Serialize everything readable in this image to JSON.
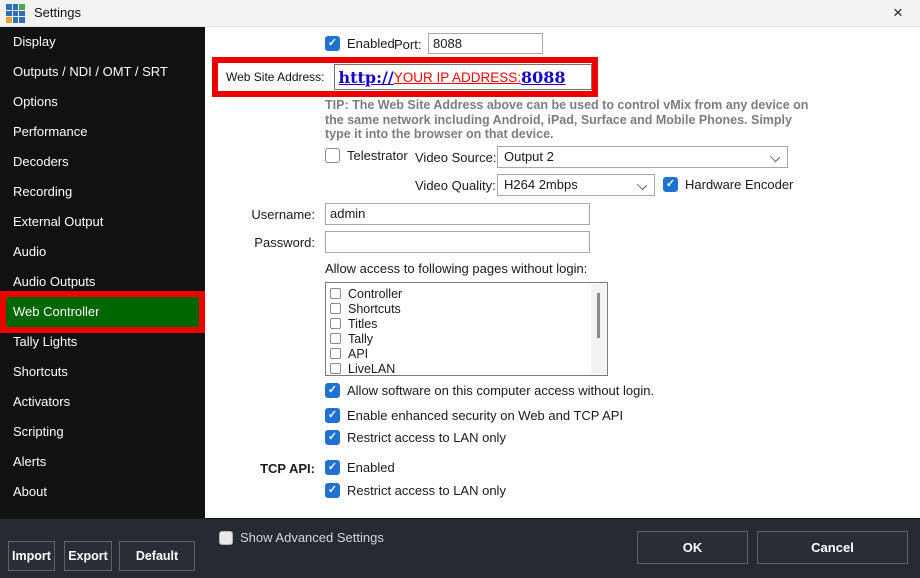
{
  "window": {
    "title": "Settings",
    "close_glyph": "×"
  },
  "colors": {
    "accent_checkbox_blue": "#1f72d1",
    "selected_item_green": "#006600",
    "annotation_red": "#ee0000",
    "url_blue": "#1803d1",
    "url_red": "#ff0000",
    "sidebar_bg": "#0f1113",
    "bottombar_bg": "#262b33"
  },
  "sidebar": {
    "items": [
      {
        "label": "Display",
        "selected": false
      },
      {
        "label": "Outputs / NDI / OMT / SRT",
        "selected": false
      },
      {
        "label": "Options",
        "selected": false
      },
      {
        "label": "Performance",
        "selected": false
      },
      {
        "label": "Decoders",
        "selected": false
      },
      {
        "label": "Recording",
        "selected": false
      },
      {
        "label": "External Output",
        "selected": false
      },
      {
        "label": "Audio",
        "selected": false
      },
      {
        "label": "Audio Outputs",
        "selected": false
      },
      {
        "label": "Web Controller",
        "selected": true
      },
      {
        "label": "Tally Lights",
        "selected": false
      },
      {
        "label": "Shortcuts",
        "selected": false
      },
      {
        "label": "Activators",
        "selected": false
      },
      {
        "label": "Scripting",
        "selected": false
      },
      {
        "label": "Alerts",
        "selected": false
      },
      {
        "label": "About",
        "selected": false
      }
    ],
    "import_label": "Import",
    "export_label": "Export",
    "default_label": "Default"
  },
  "web_controller": {
    "enabled_label": "Enabled",
    "enabled_checked": true,
    "port_label": "Port:",
    "port_value": "8088",
    "website_label": "Web Site Address:",
    "website_url": {
      "scheme": "http://",
      "host": "YOUR IP ADDRESS:",
      "port": "8088"
    },
    "tip": "TIP: The Web Site Address above can be used to control vMix from any device on the same network including Android, iPad, Surface and Mobile Phones. Simply type it into the browser on that device.",
    "telestrator_label": "Telestrator",
    "telestrator_checked": false,
    "video_source_label": "Video Source:",
    "video_source_value": "Output 2",
    "video_quality_label": "Video Quality:",
    "video_quality_value": "H264 2mbps",
    "hardware_encoder_label": "Hardware Encoder",
    "hardware_encoder_checked": true,
    "username_label": "Username:",
    "username_value": "admin",
    "password_label": "Password:",
    "password_value": "",
    "allow_pages_label": "Allow access to following pages without login:",
    "page_options": [
      {
        "label": "Controller",
        "checked": false
      },
      {
        "label": "Shortcuts",
        "checked": false
      },
      {
        "label": "Titles",
        "checked": false
      },
      {
        "label": "Tally",
        "checked": false
      },
      {
        "label": "API",
        "checked": false
      },
      {
        "label": "LiveLAN",
        "checked": false
      }
    ],
    "allow_software_label": "Allow software on this computer access without login.",
    "allow_software_checked": true,
    "enhanced_security_label": "Enable enhanced security on Web and TCP API",
    "enhanced_security_checked": true,
    "restrict_lan_label": "Restrict access to LAN only",
    "restrict_lan_checked": true,
    "tcp_api_label": "TCP API:",
    "tcp_enabled_label": "Enabled",
    "tcp_enabled_checked": true,
    "tcp_restrict_label": "Restrict access to LAN only",
    "tcp_restrict_checked": true
  },
  "footer": {
    "show_advanced_label": "Show Advanced Settings",
    "show_advanced_checked": false,
    "ok_label": "OK",
    "cancel_label": "Cancel"
  }
}
